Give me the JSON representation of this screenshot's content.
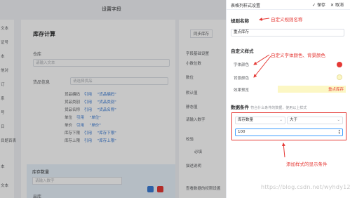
{
  "background": {
    "dialog_title": "设置字段",
    "left_items": [
      "文本",
      "证号",
      "本",
      "他对",
      "订",
      "系",
      "号",
      "日",
      "目题百表",
      "本",
      "文本"
    ],
    "section_title": "库存计算",
    "warehouse_label": "仓库",
    "warehouse_placeholder": "请输入文本",
    "goods_label": "货品信息",
    "goods_placeholder": "请选择货品",
    "mapping_rows": [
      {
        "name": "货品编码",
        "ref": "引用",
        "value": "\"货品编码\""
      },
      {
        "name": "货品类别",
        "ref": "引用",
        "value": "\"货品类别\""
      },
      {
        "name": "货品名称",
        "ref": "引用",
        "value": "\"货品名称\""
      },
      {
        "name": "单位",
        "ref": "引用",
        "value": "\"单位\""
      },
      {
        "name": "单价",
        "ref": "引用",
        "value": "\"单价\""
      },
      {
        "name": "库存下限",
        "ref": "引用",
        "value": "\"库存下限\""
      },
      {
        "name": "库存上限",
        "ref": "引用",
        "value": "\"库存上限\""
      }
    ],
    "stock_label": "库存数量",
    "stock_placeholder": "请输入数字",
    "bottom_label": "出库",
    "right_panel": {
      "sync_button": "同步库存",
      "base_settings": "字段基础设置",
      "decimal": "小数位数",
      "unit": "数位",
      "default_value_label": "默认值",
      "static_value": "静态值",
      "placeholder_hint": "请输入数字",
      "validation": "校验",
      "required": "必填",
      "description_label": "描述说明",
      "permission": "查看数据的权限设置"
    }
  },
  "drawer": {
    "title": "表格列样式设置",
    "save_label": "保存",
    "cancel_label": "取消",
    "rule_name_title": "规则名称",
    "rule_name_value": "重点库存",
    "custom_style_title": "自定义样式",
    "font_color_label": "字体颜色",
    "bg_color_label": "背景颜色",
    "preview_label": "效果预览",
    "preview_text": "重点库存",
    "font_color": "#e53935",
    "bg_color": "#fcf7c4",
    "data_condition_title": "数据条件",
    "data_condition_hint": "符合什么条件的数据，使用以上样式",
    "condition_field": "库存数量",
    "condition_operator": "大于",
    "condition_value": "100"
  },
  "annotations": {
    "rule_name": "自定义规则名称",
    "style": "自定义字体颜色、背景颜色",
    "condition": "添加样式的显示条件"
  },
  "watermark": "https://blog.csdn.net/wyhdy123"
}
